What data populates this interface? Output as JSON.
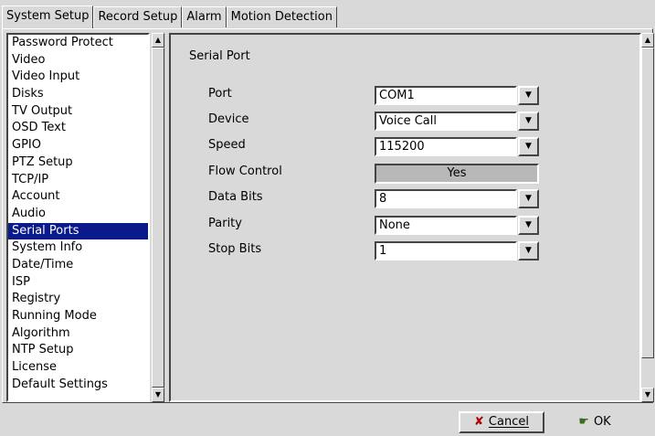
{
  "tabs": [
    "System Setup",
    "Record Setup",
    "Alarm",
    "Motion Detection"
  ],
  "sidebar": {
    "items": [
      "Password Protect",
      "Video",
      "Video Input",
      "Disks",
      "TV Output",
      "OSD Text",
      "GPIO",
      "PTZ Setup",
      "TCP/IP",
      "Account",
      "Audio",
      "Serial Ports",
      "System Info",
      "Date/Time",
      "ISP",
      "Registry",
      "Running Mode",
      "Algorithm",
      "NTP Setup",
      "License",
      "Default Settings"
    ],
    "selected": "Serial Ports"
  },
  "panel": {
    "title": "Serial Port",
    "fields": {
      "port": {
        "label": "Port",
        "value": "COM1"
      },
      "device": {
        "label": "Device",
        "value": "Voice Call"
      },
      "speed": {
        "label": "Speed",
        "value": "115200"
      },
      "flow_control": {
        "label": "Flow Control",
        "value": "Yes"
      },
      "data_bits": {
        "label": "Data Bits",
        "value": "8"
      },
      "parity": {
        "label": "Parity",
        "value": "None"
      },
      "stop_bits": {
        "label": "Stop Bits",
        "value": "1"
      }
    }
  },
  "buttons": {
    "cancel": "Cancel",
    "ok": "OK"
  },
  "icons": {
    "cancel": "x-icon",
    "ok": "hand-check-icon",
    "dropdown": "chevron-down-icon"
  },
  "colors": {
    "selection": "#0a1a8a",
    "background": "#d9d9d9"
  }
}
